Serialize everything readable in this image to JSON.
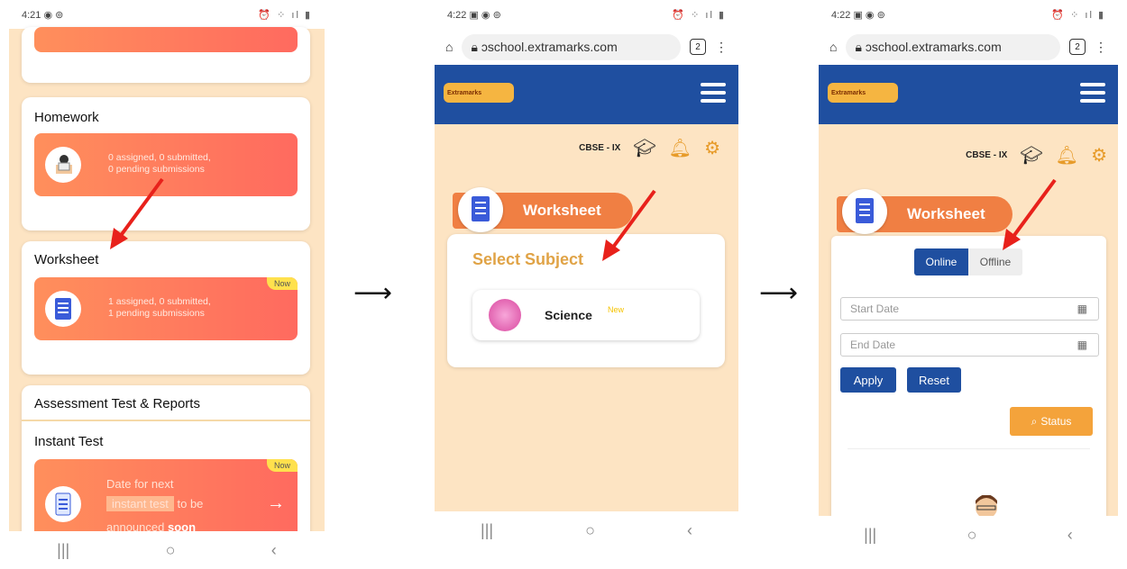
{
  "screens": [
    {
      "status": {
        "time": "4:21",
        "icons": "◉ ⊚",
        "right": "⏰ ⁘ ıl ▮"
      },
      "homework": {
        "title": "Homework",
        "text1": "0 assigned, 0 submitted,",
        "text2": "0 pending submissions"
      },
      "worksheet": {
        "title": "Worksheet",
        "badge": "Now",
        "text1": "1 assigned, 0 submitted,",
        "text2": "1 pending submissions"
      },
      "assessment": {
        "title": "Assessment Test & Reports"
      },
      "instant": {
        "title": "Instant Test",
        "badge": "Now",
        "line1": "Date for next",
        "highlight": "instant test",
        "line2b": "to be",
        "line3a": "announced",
        "line3b": "soon",
        "arrow": "→"
      }
    },
    {
      "status": {
        "time": "4:22",
        "icons": "▣ ◉ ⊚",
        "right": "⏰ ⁘ ıl ▮"
      },
      "url": "ɔschool.extramarks.com",
      "tabs": "2",
      "logo": "Extramarks",
      "class_label": "CBSE - IX",
      "notif_count": "0",
      "section": "Worksheet",
      "select_subject": "Select Subject",
      "subject": {
        "name": "Science",
        "badge": "New"
      }
    },
    {
      "status": {
        "time": "4:22",
        "icons": "▣ ◉ ⊚",
        "right": "⏰ ⁘ ıl ▮"
      },
      "url": "ɔschool.extramarks.com",
      "tabs": "2",
      "logo": "Extramarks",
      "class_label": "CBSE - IX",
      "notif_count": "0",
      "section": "Worksheet",
      "toggle": {
        "online": "Online",
        "offline": "Offline"
      },
      "start_placeholder": "Start Date",
      "end_placeholder": "End Date",
      "apply": "Apply",
      "reset": "Reset",
      "status_btn": "Status"
    }
  ],
  "flow_arrows": [
    "⟶",
    "⟶"
  ],
  "colors": {
    "brand_blue": "#1f4fa0",
    "orange": "#f07f43",
    "peach": "#fde4c3",
    "red_arrow": "#e8211b"
  }
}
